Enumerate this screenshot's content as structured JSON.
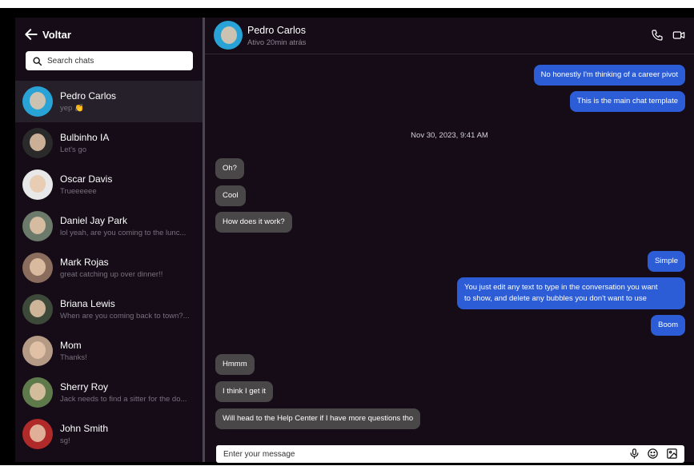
{
  "sidebar": {
    "back_label": "Voltar",
    "search_placeholder": "Search chats",
    "contacts": [
      {
        "name": "Pedro Carlos",
        "preview": "yep 👏",
        "active": true,
        "avatar_color": "#29a3d6"
      },
      {
        "name": "Bulbinho IA",
        "preview": "Let's go",
        "active": false,
        "avatar_color": "#2a2a2a"
      },
      {
        "name": "Oscar Davis",
        "preview": "Trueeeeee",
        "active": false,
        "avatar_color": "#e8e8e8"
      },
      {
        "name": "Daniel Jay Park",
        "preview": "lol yeah, are you coming to the lunc...",
        "active": false,
        "avatar_color": "#6b7a6a"
      },
      {
        "name": "Mark Rojas",
        "preview": "great catching up over dinner!!",
        "active": false,
        "avatar_color": "#8a6d5c"
      },
      {
        "name": "Briana Lewis",
        "preview": "When are you coming back to town?...",
        "active": false,
        "avatar_color": "#3d4a3a"
      },
      {
        "name": "Mom",
        "preview": "Thanks!",
        "active": false,
        "avatar_color": "#b59a86"
      },
      {
        "name": "Sherry Roy",
        "preview": "Jack needs to find a sitter for the do...",
        "active": false,
        "avatar_color": "#5f7a4a"
      },
      {
        "name": "John Smith",
        "preview": "sg!",
        "active": false,
        "avatar_color": "#b02a2a"
      }
    ]
  },
  "chat": {
    "contact_name": "Pedro Carlos",
    "status": "Ativo 20min atrás",
    "timestamp": "Nov 30, 2023, 9:41 AM",
    "messages": [
      {
        "text": "No honestly I'm thinking of a career pivot",
        "direction": "out"
      },
      {
        "text": "This is the main chat template",
        "direction": "out"
      },
      {
        "text": "Oh?",
        "direction": "in"
      },
      {
        "text": "Cool",
        "direction": "in"
      },
      {
        "text": "How does it work?",
        "direction": "in"
      },
      {
        "text": "Simple",
        "direction": "out"
      },
      {
        "text": "You just edit any text to type in the conversation you want",
        "direction": "out"
      },
      {
        "text": "to show, and delete any bubbles you don't want to use",
        "direction": "out"
      },
      {
        "text": "Boom",
        "direction": "out"
      },
      {
        "text": "Hmmm",
        "direction": "in"
      },
      {
        "text": "I think I get it",
        "direction": "in"
      },
      {
        "text": "Will head to the Help Center if I have more questions tho",
        "direction": "in"
      }
    ],
    "composer_placeholder": "Enter your message",
    "icons": [
      "phone-icon",
      "video-icon",
      "microphone-icon",
      "emoji-icon",
      "image-icon"
    ]
  },
  "colors": {
    "background": "#150c18",
    "outgoing_bubble": "#2c5cd6",
    "incoming_bubble": "#4a4749",
    "active_contact": "#26202a"
  }
}
